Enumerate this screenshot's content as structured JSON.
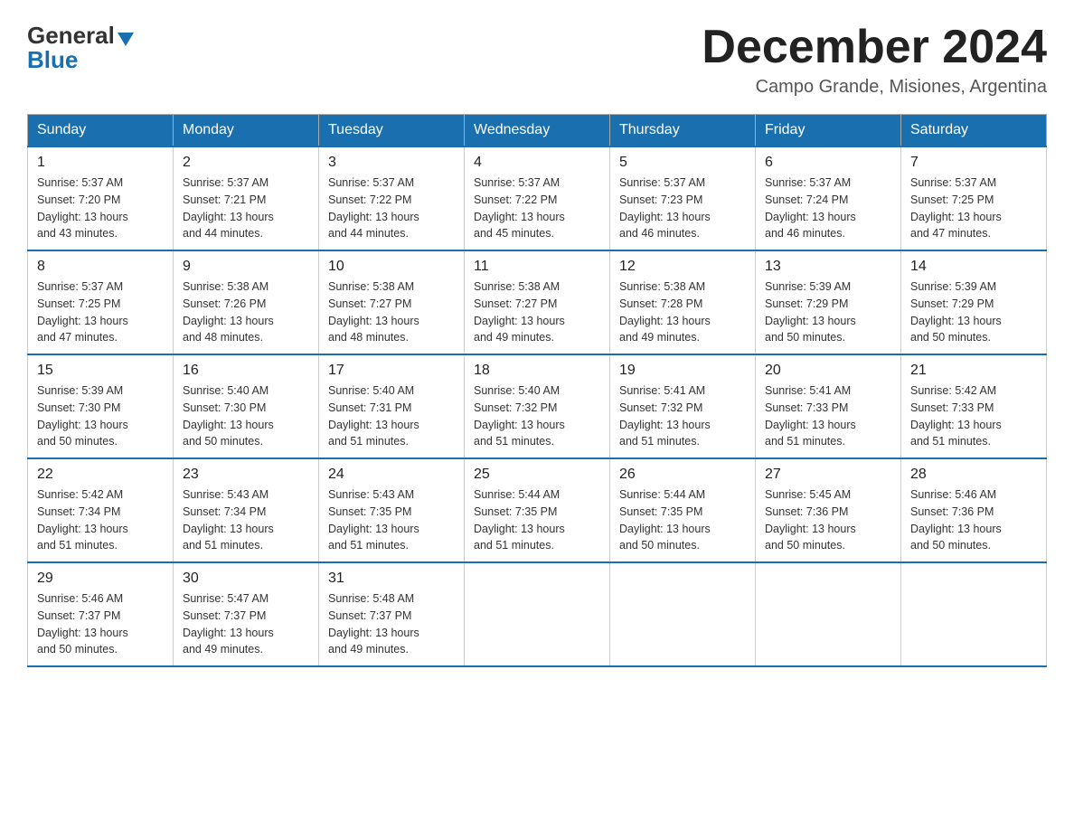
{
  "logo": {
    "line1": "General",
    "line2": "Blue"
  },
  "title": "December 2024",
  "subtitle": "Campo Grande, Misiones, Argentina",
  "weekdays": [
    "Sunday",
    "Monday",
    "Tuesday",
    "Wednesday",
    "Thursday",
    "Friday",
    "Saturday"
  ],
  "weeks": [
    [
      {
        "day": "1",
        "sunrise": "5:37 AM",
        "sunset": "7:20 PM",
        "daylight": "13 hours and 43 minutes."
      },
      {
        "day": "2",
        "sunrise": "5:37 AM",
        "sunset": "7:21 PM",
        "daylight": "13 hours and 44 minutes."
      },
      {
        "day": "3",
        "sunrise": "5:37 AM",
        "sunset": "7:22 PM",
        "daylight": "13 hours and 44 minutes."
      },
      {
        "day": "4",
        "sunrise": "5:37 AM",
        "sunset": "7:22 PM",
        "daylight": "13 hours and 45 minutes."
      },
      {
        "day": "5",
        "sunrise": "5:37 AM",
        "sunset": "7:23 PM",
        "daylight": "13 hours and 46 minutes."
      },
      {
        "day": "6",
        "sunrise": "5:37 AM",
        "sunset": "7:24 PM",
        "daylight": "13 hours and 46 minutes."
      },
      {
        "day": "7",
        "sunrise": "5:37 AM",
        "sunset": "7:25 PM",
        "daylight": "13 hours and 47 minutes."
      }
    ],
    [
      {
        "day": "8",
        "sunrise": "5:37 AM",
        "sunset": "7:25 PM",
        "daylight": "13 hours and 47 minutes."
      },
      {
        "day": "9",
        "sunrise": "5:38 AM",
        "sunset": "7:26 PM",
        "daylight": "13 hours and 48 minutes."
      },
      {
        "day": "10",
        "sunrise": "5:38 AM",
        "sunset": "7:27 PM",
        "daylight": "13 hours and 48 minutes."
      },
      {
        "day": "11",
        "sunrise": "5:38 AM",
        "sunset": "7:27 PM",
        "daylight": "13 hours and 49 minutes."
      },
      {
        "day": "12",
        "sunrise": "5:38 AM",
        "sunset": "7:28 PM",
        "daylight": "13 hours and 49 minutes."
      },
      {
        "day": "13",
        "sunrise": "5:39 AM",
        "sunset": "7:29 PM",
        "daylight": "13 hours and 50 minutes."
      },
      {
        "day": "14",
        "sunrise": "5:39 AM",
        "sunset": "7:29 PM",
        "daylight": "13 hours and 50 minutes."
      }
    ],
    [
      {
        "day": "15",
        "sunrise": "5:39 AM",
        "sunset": "7:30 PM",
        "daylight": "13 hours and 50 minutes."
      },
      {
        "day": "16",
        "sunrise": "5:40 AM",
        "sunset": "7:30 PM",
        "daylight": "13 hours and 50 minutes."
      },
      {
        "day": "17",
        "sunrise": "5:40 AM",
        "sunset": "7:31 PM",
        "daylight": "13 hours and 51 minutes."
      },
      {
        "day": "18",
        "sunrise": "5:40 AM",
        "sunset": "7:32 PM",
        "daylight": "13 hours and 51 minutes."
      },
      {
        "day": "19",
        "sunrise": "5:41 AM",
        "sunset": "7:32 PM",
        "daylight": "13 hours and 51 minutes."
      },
      {
        "day": "20",
        "sunrise": "5:41 AM",
        "sunset": "7:33 PM",
        "daylight": "13 hours and 51 minutes."
      },
      {
        "day": "21",
        "sunrise": "5:42 AM",
        "sunset": "7:33 PM",
        "daylight": "13 hours and 51 minutes."
      }
    ],
    [
      {
        "day": "22",
        "sunrise": "5:42 AM",
        "sunset": "7:34 PM",
        "daylight": "13 hours and 51 minutes."
      },
      {
        "day": "23",
        "sunrise": "5:43 AM",
        "sunset": "7:34 PM",
        "daylight": "13 hours and 51 minutes."
      },
      {
        "day": "24",
        "sunrise": "5:43 AM",
        "sunset": "7:35 PM",
        "daylight": "13 hours and 51 minutes."
      },
      {
        "day": "25",
        "sunrise": "5:44 AM",
        "sunset": "7:35 PM",
        "daylight": "13 hours and 51 minutes."
      },
      {
        "day": "26",
        "sunrise": "5:44 AM",
        "sunset": "7:35 PM",
        "daylight": "13 hours and 50 minutes."
      },
      {
        "day": "27",
        "sunrise": "5:45 AM",
        "sunset": "7:36 PM",
        "daylight": "13 hours and 50 minutes."
      },
      {
        "day": "28",
        "sunrise": "5:46 AM",
        "sunset": "7:36 PM",
        "daylight": "13 hours and 50 minutes."
      }
    ],
    [
      {
        "day": "29",
        "sunrise": "5:46 AM",
        "sunset": "7:37 PM",
        "daylight": "13 hours and 50 minutes."
      },
      {
        "day": "30",
        "sunrise": "5:47 AM",
        "sunset": "7:37 PM",
        "daylight": "13 hours and 49 minutes."
      },
      {
        "day": "31",
        "sunrise": "5:48 AM",
        "sunset": "7:37 PM",
        "daylight": "13 hours and 49 minutes."
      },
      null,
      null,
      null,
      null
    ]
  ],
  "labels": {
    "sunrise": "Sunrise:",
    "sunset": "Sunset:",
    "daylight": "Daylight:"
  }
}
